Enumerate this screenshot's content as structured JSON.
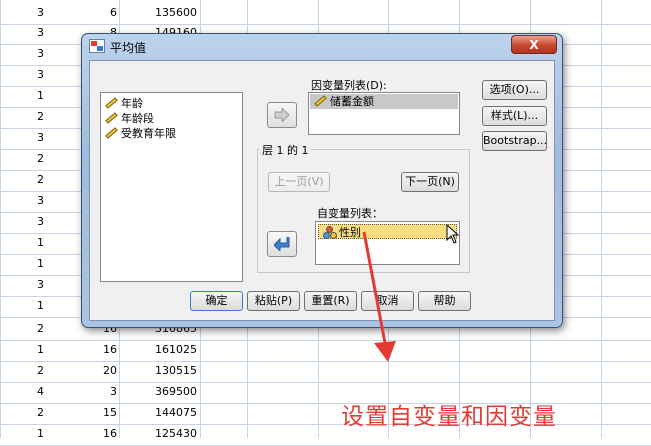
{
  "sheet": {
    "col_a": [
      "3",
      "3",
      "3",
      "3",
      "1",
      "2",
      "3",
      "2",
      "2",
      "3",
      "3",
      "1",
      "1",
      "3",
      "1",
      "2",
      "1",
      "2",
      "4",
      "2",
      "1"
    ],
    "col_b": [
      "6",
      "8",
      "",
      "",
      "",
      "",
      "",
      "",
      "",
      "",
      "",
      "",
      "",
      "",
      "",
      "16",
      "16",
      "20",
      "3",
      "15",
      "16"
    ],
    "col_c": [
      "135600",
      "149160",
      "",
      "",
      "",
      "",
      "",
      "",
      "",
      "",
      "",
      "",
      "",
      "",
      "",
      "310865",
      "161025",
      "130515",
      "369500",
      "144075",
      "125430"
    ]
  },
  "dialog": {
    "title": "平均值",
    "close_label": "X",
    "source_list": [
      "年龄",
      "年龄段",
      "受教育年限"
    ],
    "dependent_label": "因变量列表(D):",
    "dependent_items": [
      "储蓄金额"
    ],
    "layer_label": "层 1 的 1",
    "prev_button": "上一页(V)",
    "next_button": "下一页(N)",
    "independent_label": "自变量列表：",
    "independent_items": [
      "性别"
    ],
    "side_buttons": [
      "选项(O)...",
      "样式(L)...",
      "Bootstrap..."
    ],
    "bottom_buttons": [
      "确定",
      "粘贴(P)",
      "重置(R)",
      "取消",
      "帮助"
    ]
  },
  "annotation": {
    "caption": "设置自变量和因变量",
    "color": "#e33b33"
  },
  "icons": {
    "scale": "ruler-scale-icon",
    "nominal": "nominal-variable-icon",
    "move_right": "arrow-right-icon",
    "move_back": "arrow-back-icon"
  }
}
